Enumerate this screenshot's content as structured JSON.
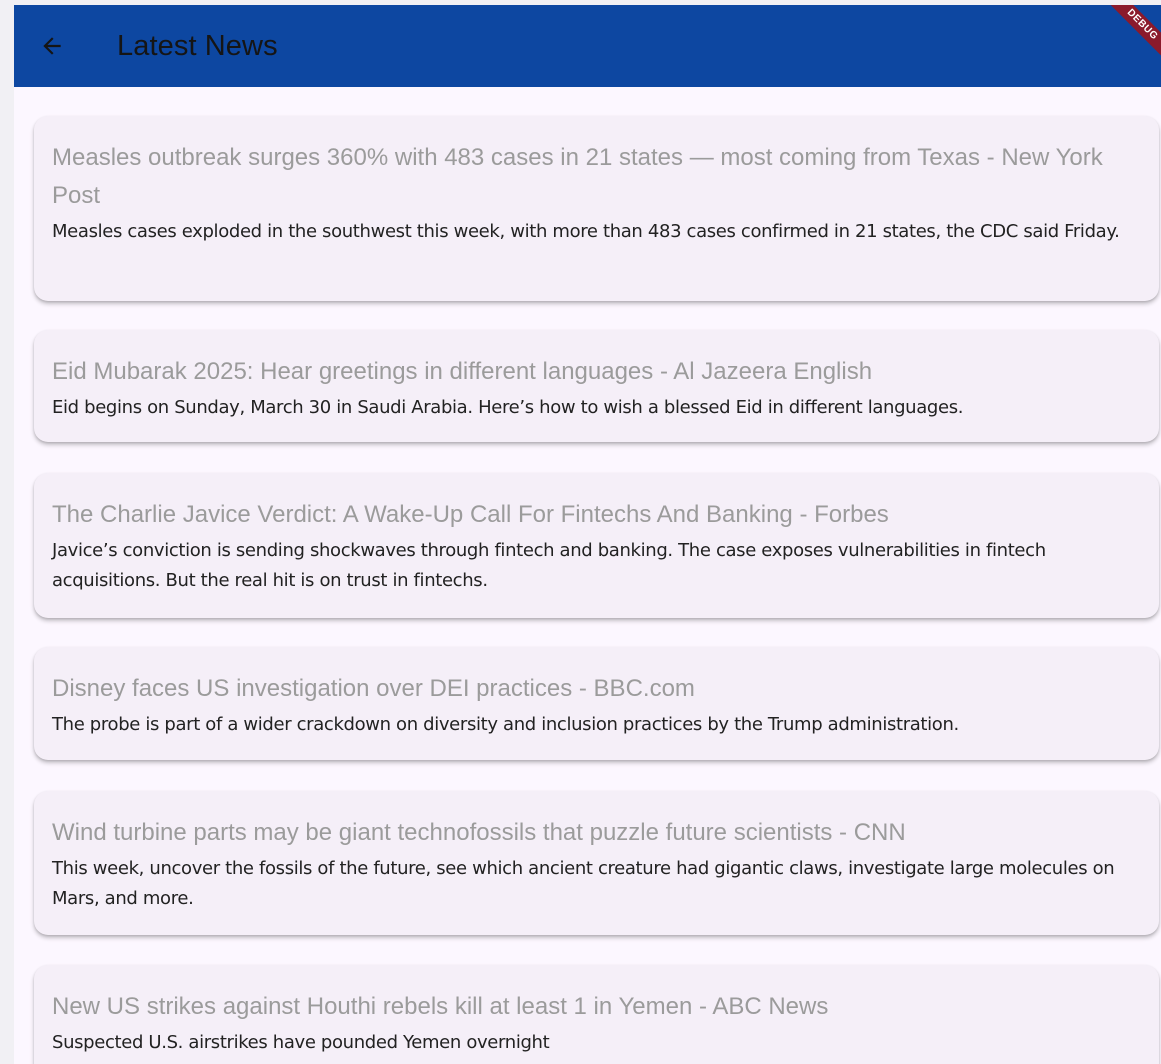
{
  "appbar": {
    "title": "Latest News",
    "back_icon": "arrow-back-icon",
    "background": "#0d47a1",
    "debug_banner": "DEBUG"
  },
  "articles": [
    {
      "title": "Measles outbreak surges 360% with 483 cases in 21 states — most coming from Texas - New York Post",
      "description": "Measles cases exploded in the southwest this week, with more than 483 cases confirmed in 21 states, the CDC said Friday."
    },
    {
      "title": "Eid Mubarak 2025: Hear greetings in different languages - Al Jazeera English",
      "description": "Eid begins on Sunday, March 30 in Saudi Arabia. Here’s how to wish a blessed Eid in different languages."
    },
    {
      "title": "The Charlie Javice Verdict: A Wake-Up Call For Fintechs And Banking - Forbes",
      "description": "Javice’s conviction is sending shockwaves through fintech and banking. The case exposes vulnerabilities in fintech acquisitions. But the real hit is on trust in fintechs."
    },
    {
      "title": "Disney faces US investigation over DEI practices - BBC.com",
      "description": "The probe is part of a wider crackdown on diversity and inclusion practices by the Trump administration."
    },
    {
      "title": "Wind turbine parts may be giant technofossils that puzzle future scientists - CNN",
      "description": "This week, uncover the fossils of the future, see which ancient creature had gigantic claws, investigate large molecules on Mars, and more."
    },
    {
      "title": "New US strikes against Houthi rebels kill at least 1 in Yemen - ABC News",
      "description": "Suspected U.S. airstrikes have pounded Yemen overnight"
    }
  ]
}
